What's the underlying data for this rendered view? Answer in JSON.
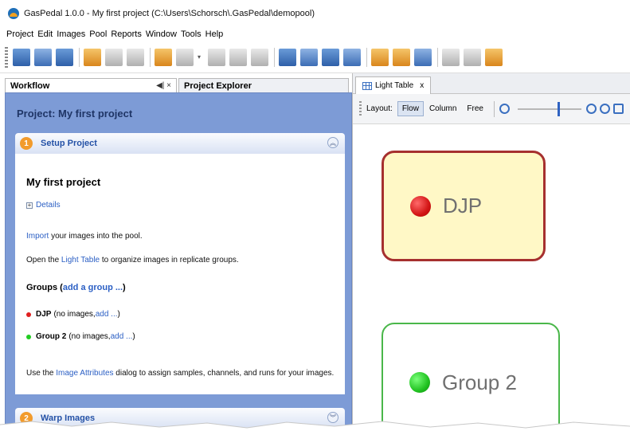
{
  "window": {
    "title": "GasPedal 1.0.0 - My first project (C:\\Users\\Schorsch\\.GasPedal\\demopool)"
  },
  "menu": [
    "Project",
    "Edit",
    "Images",
    "Pool",
    "Reports",
    "Window",
    "Tools",
    "Help"
  ],
  "left_tabs": {
    "workflow": "Workflow",
    "workflow_ctrl": "◀| ×",
    "explorer": "Project Explorer"
  },
  "workflow": {
    "header": "Project: My first project",
    "step1": {
      "num": "1",
      "title": "Setup Project"
    },
    "step2": {
      "num": "2",
      "title": "Warp Images"
    },
    "project_name": "My first project",
    "details": "Details",
    "import_link": "Import",
    "import_rest": " your images into the pool.",
    "open_pre": "Open the ",
    "open_link": "Light Table",
    "open_post": " to organize images in replicate groups.",
    "groups_title": "Groups (",
    "groups_link": "add a group ...",
    "groups_close": ")",
    "groups": [
      {
        "name": "DJP",
        "pre": "(no images, ",
        "link": "add ...",
        "post": ")",
        "color": "#e02020"
      },
      {
        "name": "Group 2",
        "pre": "(no images, ",
        "link": "add ...",
        "post": ")",
        "color": "#22cc22"
      }
    ],
    "attr_pre": "Use the ",
    "attr_link": "Image Attributes",
    "attr_post": " dialog to assign samples, channels, and runs for your images."
  },
  "light_table": {
    "tab": "Light Table",
    "close": "x",
    "layout_label": "Layout:",
    "layout_options": [
      "Flow",
      "Column",
      "Free"
    ],
    "active_layout": "Flow",
    "groups": [
      {
        "label": "DJP",
        "dot_color": "#e02020",
        "border": "#a6302f",
        "fill": "#fff8c6"
      },
      {
        "label": "Group 2",
        "dot_color": "#22cc22",
        "border": "#4ab74a",
        "fill": "#ffffff"
      }
    ]
  },
  "icons": [
    "app-logo-icon",
    "grid-icon",
    "zoom-out-icon",
    "zoom-in-icon",
    "zoom-fit-icon"
  ]
}
